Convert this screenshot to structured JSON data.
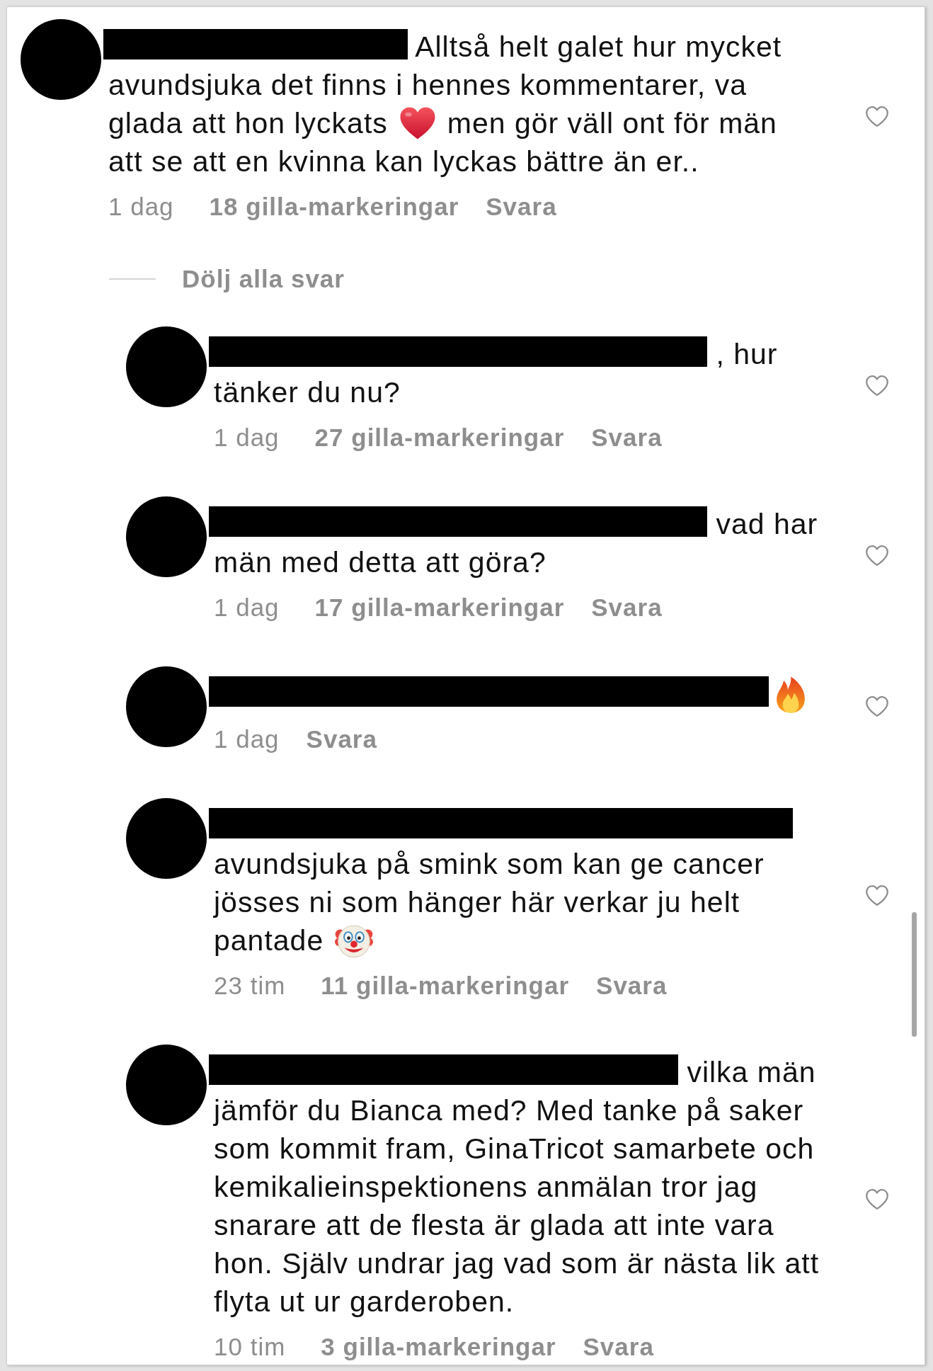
{
  "comment": {
    "lines": [
      [
        {
          "kind": "redacted"
        },
        {
          "kind": "text",
          "text": "Alltså helt galet hur mycket"
        }
      ],
      [
        {
          "kind": "text",
          "text": "avundsjuka det finns i hennes kommentarer, va"
        }
      ],
      [
        {
          "kind": "text",
          "text": "glada att hon lyckats"
        },
        {
          "kind": "heart"
        },
        {
          "kind": "text",
          "text": "men gör väll ont för män"
        }
      ],
      [
        {
          "kind": "text",
          "text": "att se att en kvinna kan lyckas bättre än er.."
        }
      ]
    ],
    "time": "1 dag",
    "likes": "18 gilla-markeringar",
    "reply": "Svara",
    "liked": false
  },
  "replies_toggle": "Dölj alla svar",
  "replies": [
    {
      "lines": [
        [
          {
            "kind": "redacted"
          },
          {
            "kind": "text",
            "text": ", hur"
          }
        ],
        [
          {
            "kind": "text",
            "text": "tänker du nu?"
          }
        ]
      ],
      "time": "1 dag",
      "likes": "27 gilla-markeringar",
      "reply": "Svara",
      "liked": false
    },
    {
      "lines": [
        [
          {
            "kind": "redacted"
          },
          {
            "kind": "text",
            "text": "vad har"
          }
        ],
        [
          {
            "kind": "text",
            "text": "män med detta att göra?"
          }
        ]
      ],
      "time": "1 dag",
      "likes": "17 gilla-markeringar",
      "reply": "Svara",
      "liked": false
    },
    {
      "lines": [
        [
          {
            "kind": "redacted"
          },
          {
            "kind": "fire"
          }
        ]
      ],
      "time": "1 dag",
      "reply": "Svara",
      "liked": false
    },
    {
      "lines": [
        [
          {
            "kind": "redacted"
          }
        ],
        [
          {
            "kind": "text",
            "text": "avundsjuka på smink som kan ge cancer"
          }
        ],
        [
          {
            "kind": "text",
            "text": "jösses ni som hänger här verkar ju helt"
          }
        ],
        [
          {
            "kind": "text",
            "text": "pantade"
          },
          {
            "kind": "clown"
          }
        ]
      ],
      "time": "23 tim",
      "likes": "11 gilla-markeringar",
      "reply": "Svara",
      "liked": false
    },
    {
      "lines": [
        [
          {
            "kind": "redacted"
          },
          {
            "kind": "text",
            "text": "vilka män"
          }
        ],
        [
          {
            "kind": "text",
            "text": "jämför du Bianca med? Med tanke på saker"
          }
        ],
        [
          {
            "kind": "text",
            "text": "som kommit fram, GinaTricot samarbete och"
          }
        ],
        [
          {
            "kind": "text",
            "text": "kemikalieinspektionens anmälan tror jag"
          }
        ],
        [
          {
            "kind": "text",
            "text": "snarare att de flesta är glada att inte vara"
          }
        ],
        [
          {
            "kind": "text",
            "text": "hon. Själv undrar jag vad som är nästa lik att"
          }
        ],
        [
          {
            "kind": "text",
            "text": "flyta ut ur garderoben."
          }
        ]
      ],
      "time": "10 tim",
      "likes": "3 gilla-markeringar",
      "reply": "Svara",
      "liked": false
    }
  ]
}
